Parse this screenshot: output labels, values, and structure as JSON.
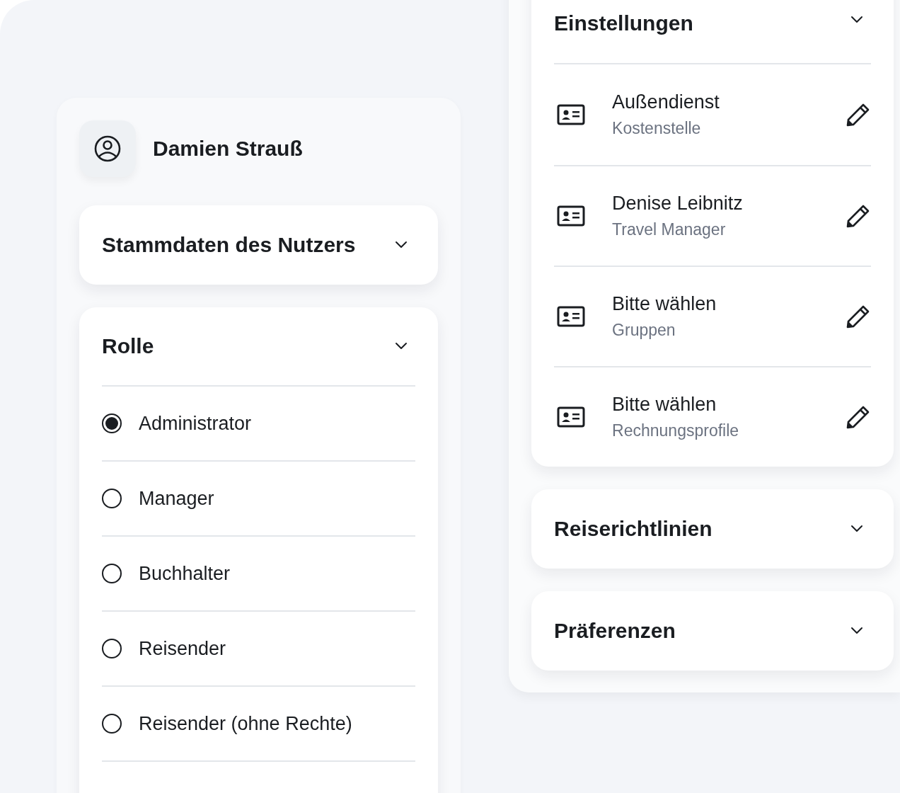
{
  "user": {
    "name": "Damien Strauß"
  },
  "sections_left": [
    {
      "title": "Stammdaten des Nutzers"
    }
  ],
  "role": {
    "title": "Rolle",
    "options": [
      {
        "label": "Administrator",
        "selected": true
      },
      {
        "label": "Manager",
        "selected": false
      },
      {
        "label": "Buchhalter",
        "selected": false
      },
      {
        "label": "Reisender",
        "selected": false
      },
      {
        "label": "Reisender (ohne Rechte)",
        "selected": false
      }
    ]
  },
  "settings": {
    "title": "Einstellungen",
    "items": [
      {
        "value": "Außendienst",
        "label": "Kostenstelle"
      },
      {
        "value": "Denise Leibnitz",
        "label": "Travel Manager"
      },
      {
        "value": "Bitte wählen",
        "label": "Gruppen"
      },
      {
        "value": "Bitte wählen",
        "label": "Rechnungsprofile"
      }
    ]
  },
  "sections_right": [
    {
      "title": "Reiserichtlinien"
    },
    {
      "title": "Präferenzen"
    }
  ]
}
